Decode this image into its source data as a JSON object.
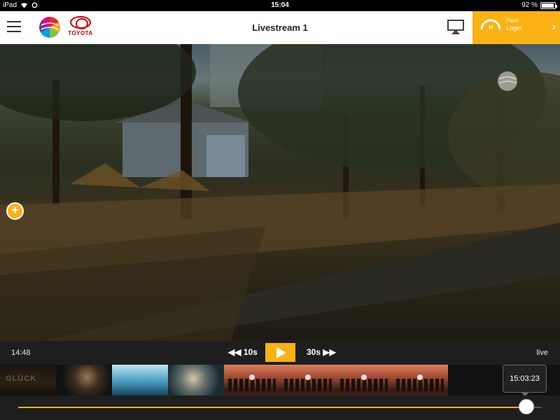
{
  "status_bar": {
    "device": "iPad",
    "time": "15:04",
    "battery_text": "92 %",
    "battery_level": 0.92
  },
  "header": {
    "title": "Livestream 1",
    "toyota_text": "TOYOTA",
    "pass_label": "Pass",
    "login_label": "Login",
    "accent_color": "#fbb214",
    "icons": [
      "menu-icon",
      "sat1-logo",
      "toyota-logo",
      "airplay-icon",
      "speedometer-icon",
      "chevron-right-icon"
    ]
  },
  "video": {
    "add_icon": "plus-icon",
    "watermark": "sat1-logo"
  },
  "controls": {
    "current_time": "14:48",
    "rewind_label": "10s",
    "forward_label": "30s",
    "live_label": "live",
    "play_icon": "play-icon"
  },
  "thumbnails": [
    {
      "label": "GLÜCK"
    },
    {
      "label": ""
    },
    {
      "label": ""
    },
    {
      "label": ""
    },
    {
      "label": ""
    },
    {
      "label": ""
    },
    {
      "label": ""
    },
    {
      "label": ""
    }
  ],
  "timeline": {
    "tooltip_time": "15:03:23",
    "progress": 0.97
  }
}
